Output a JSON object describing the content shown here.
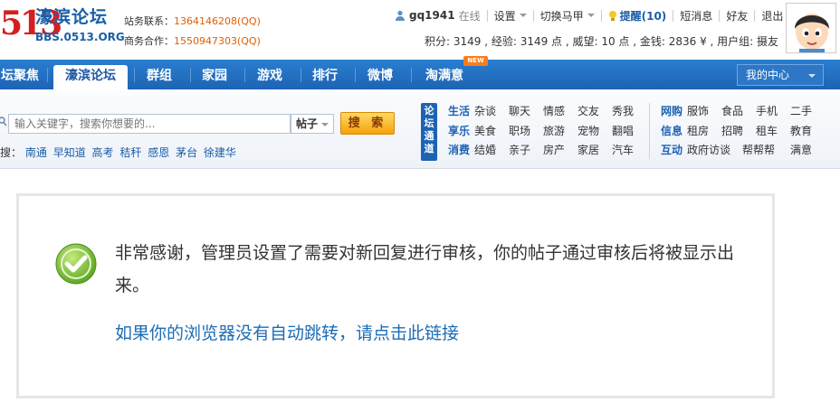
{
  "header": {
    "logo": {
      "mark": "513",
      "name": "濠滨论坛",
      "url": "BBS.0513.ORG"
    },
    "contact": [
      {
        "label": "站务联系：",
        "value": "1364146208(QQ)"
      },
      {
        "label": "商务合作：",
        "value": "1550947303(QQ)"
      }
    ],
    "user": {
      "name": "gq1941",
      "status": "在线",
      "settings": "设置",
      "switch_vest": "切换马甲",
      "remind": "提醒(10)",
      "messages": "短消息",
      "friends": "好友",
      "logout": "退出"
    },
    "stats": "积分: 3149 , 经验: 3149 点 , 威望: 10 点 , 金钱: 2836 ¥ , 用户组: 摄友"
  },
  "nav": {
    "items": [
      "坛聚焦",
      "濠滨论坛",
      "群组",
      "家园",
      "游戏",
      "排行",
      "微博",
      "淘满意"
    ],
    "current": "濠滨论坛",
    "new_badge": "NEW",
    "my_center": "我的中心"
  },
  "search": {
    "placeholder": "输入关键字，搜索你想要的...",
    "type": "帖子",
    "button": "搜 索",
    "hot_label": "搜：",
    "hot": [
      "南通",
      "早知道",
      "高考",
      "秸秆",
      "感恩",
      "茅台",
      "徐建华"
    ]
  },
  "channels": {
    "title": "论坛通道",
    "left": [
      {
        "key": "生活",
        "items": [
          "杂谈",
          "聊天",
          "情感",
          "交友",
          "秀我"
        ]
      },
      {
        "key": "享乐",
        "items": [
          "美食",
          "职场",
          "旅游",
          "宠物",
          "翻唱"
        ]
      },
      {
        "key": "消费",
        "items": [
          "结婚",
          "亲子",
          "房产",
          "家居",
          "汽车"
        ]
      }
    ],
    "right": [
      {
        "key": "网购",
        "items": [
          "服饰",
          "食品",
          "手机",
          "二手"
        ]
      },
      {
        "key": "信息",
        "items": [
          "租房",
          "招聘",
          "租车",
          "教育"
        ]
      },
      {
        "key": "互动",
        "items": [
          "政府访谈",
          "帮帮帮",
          "满意"
        ]
      }
    ]
  },
  "message": {
    "text": "非常感谢，管理员设置了需要对新回复进行审核，你的帖子通过审核后将被显示出来。",
    "link": "如果你的浏览器没有自动跳转，请点击此链接"
  },
  "colors": {
    "nav_blue": "#1d63b3",
    "link_blue": "#1d6cb5",
    "accent_orange": "#f5a20b",
    "ok_green": "#7cc23a"
  }
}
